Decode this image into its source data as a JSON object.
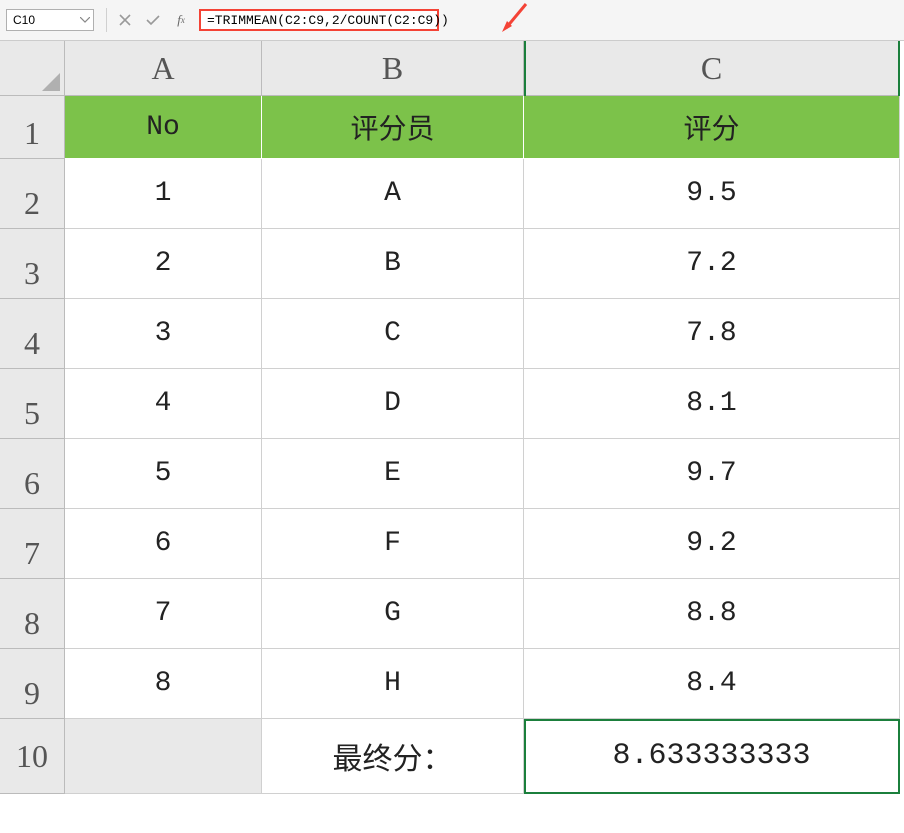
{
  "formula_bar": {
    "cell_ref": "C10",
    "formula": "=TRIMMEAN(C2:C9,2/COUNT(C2:C9))"
  },
  "columns": [
    "A",
    "B",
    "C"
  ],
  "row_numbers": [
    "1",
    "2",
    "3",
    "4",
    "5",
    "6",
    "7",
    "8",
    "9",
    "10"
  ],
  "header_row": {
    "A": "No",
    "B": "评分员",
    "C": "评分"
  },
  "data_rows": [
    {
      "A": "1",
      "B": "A",
      "C": "9.5"
    },
    {
      "A": "2",
      "B": "B",
      "C": "7.2"
    },
    {
      "A": "3",
      "B": "C",
      "C": "7.8"
    },
    {
      "A": "4",
      "B": "D",
      "C": "8.1"
    },
    {
      "A": "5",
      "B": "E",
      "C": "9.7"
    },
    {
      "A": "6",
      "B": "F",
      "C": "9.2"
    },
    {
      "A": "7",
      "B": "G",
      "C": "8.8"
    },
    {
      "A": "8",
      "B": "H",
      "C": "8.4"
    }
  ],
  "footer_row": {
    "A": "",
    "B": "最终分：",
    "C": "8.633333333"
  }
}
